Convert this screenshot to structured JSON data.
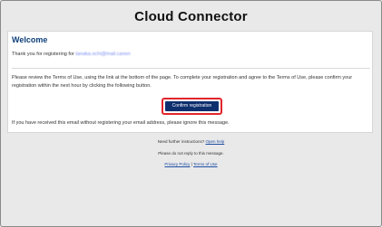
{
  "header": {
    "brand": "Cloud Connector"
  },
  "card": {
    "welcome": "Welcome",
    "thanks_prefix": "Thank you for registering for",
    "email_blurred": "tanaka.ochi@mail.canon",
    "review_text": "Please review the Terms of Use, using the link at the bottom of the page. To complete your registration and agree to the Terms of Use, please confirm your registration within the next hour by clicking the following button.",
    "confirm_button": "Confirm registration",
    "ignore_text": "If you have received this email without registering your email address, please ignore this message."
  },
  "footer": {
    "help_prefix": "Need further instructions?",
    "help_link": "Open help",
    "no_reply": "Please do not reply to this message.",
    "privacy_link": "Privacy Policy",
    "separator": "|",
    "terms_link": "Terms of Use"
  }
}
